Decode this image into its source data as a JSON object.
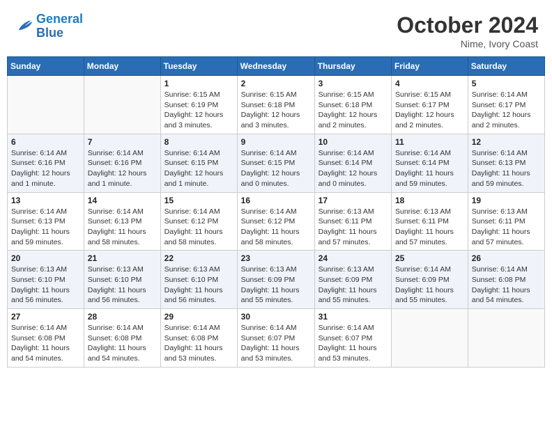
{
  "header": {
    "logo_line1": "General",
    "logo_line2": "Blue",
    "month": "October 2024",
    "location": "Nime, Ivory Coast"
  },
  "weekdays": [
    "Sunday",
    "Monday",
    "Tuesday",
    "Wednesday",
    "Thursday",
    "Friday",
    "Saturday"
  ],
  "weeks": [
    [
      {
        "day": "",
        "info": ""
      },
      {
        "day": "",
        "info": ""
      },
      {
        "day": "1",
        "info": "Sunrise: 6:15 AM\nSunset: 6:19 PM\nDaylight: 12 hours and 3 minutes."
      },
      {
        "day": "2",
        "info": "Sunrise: 6:15 AM\nSunset: 6:18 PM\nDaylight: 12 hours and 3 minutes."
      },
      {
        "day": "3",
        "info": "Sunrise: 6:15 AM\nSunset: 6:18 PM\nDaylight: 12 hours and 2 minutes."
      },
      {
        "day": "4",
        "info": "Sunrise: 6:15 AM\nSunset: 6:17 PM\nDaylight: 12 hours and 2 minutes."
      },
      {
        "day": "5",
        "info": "Sunrise: 6:14 AM\nSunset: 6:17 PM\nDaylight: 12 hours and 2 minutes."
      }
    ],
    [
      {
        "day": "6",
        "info": "Sunrise: 6:14 AM\nSunset: 6:16 PM\nDaylight: 12 hours and 1 minute."
      },
      {
        "day": "7",
        "info": "Sunrise: 6:14 AM\nSunset: 6:16 PM\nDaylight: 12 hours and 1 minute."
      },
      {
        "day": "8",
        "info": "Sunrise: 6:14 AM\nSunset: 6:15 PM\nDaylight: 12 hours and 1 minute."
      },
      {
        "day": "9",
        "info": "Sunrise: 6:14 AM\nSunset: 6:15 PM\nDaylight: 12 hours and 0 minutes."
      },
      {
        "day": "10",
        "info": "Sunrise: 6:14 AM\nSunset: 6:14 PM\nDaylight: 12 hours and 0 minutes."
      },
      {
        "day": "11",
        "info": "Sunrise: 6:14 AM\nSunset: 6:14 PM\nDaylight: 11 hours and 59 minutes."
      },
      {
        "day": "12",
        "info": "Sunrise: 6:14 AM\nSunset: 6:13 PM\nDaylight: 11 hours and 59 minutes."
      }
    ],
    [
      {
        "day": "13",
        "info": "Sunrise: 6:14 AM\nSunset: 6:13 PM\nDaylight: 11 hours and 59 minutes."
      },
      {
        "day": "14",
        "info": "Sunrise: 6:14 AM\nSunset: 6:13 PM\nDaylight: 11 hours and 58 minutes."
      },
      {
        "day": "15",
        "info": "Sunrise: 6:14 AM\nSunset: 6:12 PM\nDaylight: 11 hours and 58 minutes."
      },
      {
        "day": "16",
        "info": "Sunrise: 6:14 AM\nSunset: 6:12 PM\nDaylight: 11 hours and 58 minutes."
      },
      {
        "day": "17",
        "info": "Sunrise: 6:13 AM\nSunset: 6:11 PM\nDaylight: 11 hours and 57 minutes."
      },
      {
        "day": "18",
        "info": "Sunrise: 6:13 AM\nSunset: 6:11 PM\nDaylight: 11 hours and 57 minutes."
      },
      {
        "day": "19",
        "info": "Sunrise: 6:13 AM\nSunset: 6:11 PM\nDaylight: 11 hours and 57 minutes."
      }
    ],
    [
      {
        "day": "20",
        "info": "Sunrise: 6:13 AM\nSunset: 6:10 PM\nDaylight: 11 hours and 56 minutes."
      },
      {
        "day": "21",
        "info": "Sunrise: 6:13 AM\nSunset: 6:10 PM\nDaylight: 11 hours and 56 minutes."
      },
      {
        "day": "22",
        "info": "Sunrise: 6:13 AM\nSunset: 6:10 PM\nDaylight: 11 hours and 56 minutes."
      },
      {
        "day": "23",
        "info": "Sunrise: 6:13 AM\nSunset: 6:09 PM\nDaylight: 11 hours and 55 minutes."
      },
      {
        "day": "24",
        "info": "Sunrise: 6:13 AM\nSunset: 6:09 PM\nDaylight: 11 hours and 55 minutes."
      },
      {
        "day": "25",
        "info": "Sunrise: 6:14 AM\nSunset: 6:09 PM\nDaylight: 11 hours and 55 minutes."
      },
      {
        "day": "26",
        "info": "Sunrise: 6:14 AM\nSunset: 6:08 PM\nDaylight: 11 hours and 54 minutes."
      }
    ],
    [
      {
        "day": "27",
        "info": "Sunrise: 6:14 AM\nSunset: 6:08 PM\nDaylight: 11 hours and 54 minutes."
      },
      {
        "day": "28",
        "info": "Sunrise: 6:14 AM\nSunset: 6:08 PM\nDaylight: 11 hours and 54 minutes."
      },
      {
        "day": "29",
        "info": "Sunrise: 6:14 AM\nSunset: 6:08 PM\nDaylight: 11 hours and 53 minutes."
      },
      {
        "day": "30",
        "info": "Sunrise: 6:14 AM\nSunset: 6:07 PM\nDaylight: 11 hours and 53 minutes."
      },
      {
        "day": "31",
        "info": "Sunrise: 6:14 AM\nSunset: 6:07 PM\nDaylight: 11 hours and 53 minutes."
      },
      {
        "day": "",
        "info": ""
      },
      {
        "day": "",
        "info": ""
      }
    ]
  ]
}
